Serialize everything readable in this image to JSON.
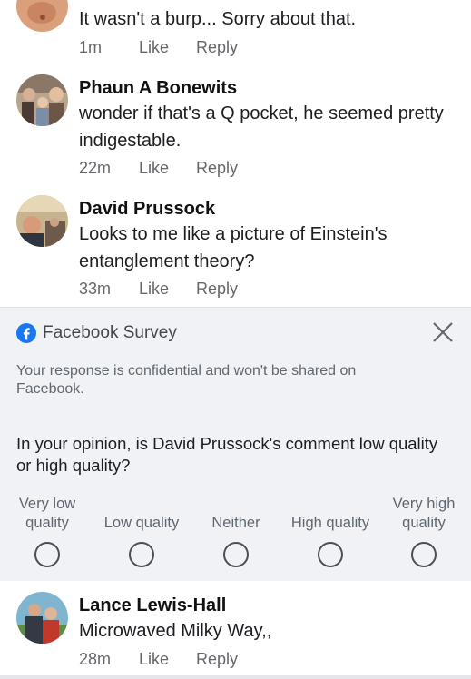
{
  "comments": [
    {
      "name": "",
      "text": "It wasn't a burp... Sorry about that.",
      "time": "1m",
      "like": "Like",
      "reply": "Reply"
    },
    {
      "name": "Phaun A Bonewits",
      "text": "wonder if that's a Q pocket, he seemed pretty indigestable.",
      "time": "22m",
      "like": "Like",
      "reply": "Reply"
    },
    {
      "name": "David Prussock",
      "text": "Looks to me like a picture of Einstein's entanglement theory?",
      "time": "33m",
      "like": "Like",
      "reply": "Reply"
    },
    {
      "name": "Lance Lewis-Hall",
      "text": "Microwaved Milky Way,,",
      "time": "28m",
      "like": "Like",
      "reply": "Reply"
    }
  ],
  "survey": {
    "title": "Facebook Survey",
    "note": "Your response is confidential and won't be shared on Facebook.",
    "question": "In your opinion, is David Prussock's comment low quality or high quality?",
    "options": [
      {
        "label": "Very low quality"
      },
      {
        "label": "Low quality"
      },
      {
        "label": "Neither"
      },
      {
        "label": "High quality"
      },
      {
        "label": "Very high quality"
      }
    ]
  },
  "colors": {
    "facebook_blue": "#1877f2",
    "meta_gray": "#65676b",
    "survey_bg": "#f0f2f5"
  },
  "icons": {
    "close": "close-icon",
    "logo": "facebook-logo-icon"
  }
}
